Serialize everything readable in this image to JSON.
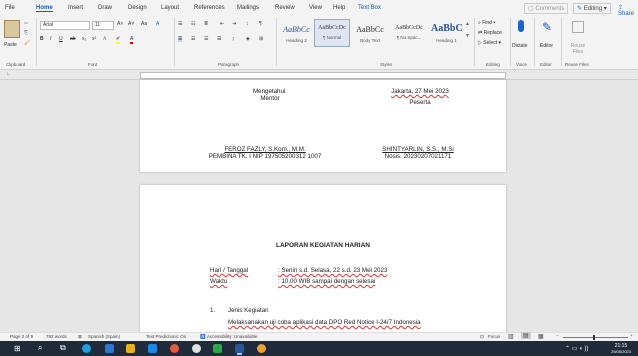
{
  "tabs": [
    "File",
    "Home",
    "Insert",
    "Draw",
    "Design",
    "Layout",
    "References",
    "Mailings",
    "Review",
    "View",
    "Help",
    "Text Box"
  ],
  "right_controls": {
    "comments": "Comments",
    "editing": "Editing",
    "share": "Share"
  },
  "clipboard": {
    "paste": "Paste",
    "group": "Clipboard"
  },
  "font": {
    "name": "Arial",
    "size": "11",
    "group": "Font"
  },
  "paragraph": {
    "group": "Paragraph"
  },
  "styles": {
    "group": "Styles",
    "items": [
      {
        "preview": "AaBbCc",
        "name": "Heading 2"
      },
      {
        "preview": "AaBbCcDc",
        "name": "¶ Normal"
      },
      {
        "preview": "AaBbCc",
        "name": "Body Text"
      },
      {
        "preview": "AaBbCcDc",
        "name": "¶ No Spac..."
      },
      {
        "preview": "AaBbC",
        "name": "Heading 1"
      }
    ]
  },
  "editing": {
    "find": "Find",
    "replace": "Replace",
    "select": "Select",
    "group": "Editing"
  },
  "voice": {
    "dictate": "Dictate",
    "group": "Voice"
  },
  "editor": {
    "label": "Editor",
    "group": "Editor"
  },
  "reuse": {
    "label": "Reuse Files",
    "group": "Reuse Files"
  },
  "page1": {
    "left_heading": "Mengetahui:",
    "left_role": "Mentor",
    "right_date": "Jakarta, 27 Mei 2023",
    "right_role": "Peserta",
    "left_name": "FEROZ FAZLY, S.Kom., M.M.",
    "left_id": "PEMBINA TK. I NIP 197505200312 1007",
    "right_name": "SHINTYARLIN, S.S., M.Si",
    "right_id": "Nosis. 20230207021171"
  },
  "page2": {
    "title": "LAPORAN KEGIATAN HARIAN",
    "row1_label": "Hari / Tanggal",
    "row1_value": ": Senin s.d. Selasa, 22 s.d. 23 Mei 2023",
    "row2_label": "Waktu",
    "row2_value": ": 10.00 WIB sampai dengan selesai",
    "item_number": "1.",
    "item_title": "Jenis Kegiatan",
    "item_text": "Melaksanakan uji coba aplikasi data DPO Red Notice I-24/7 Indonesia"
  },
  "status": {
    "page": "Page 2 of 9",
    "words": "793 words",
    "language": "Spanish (Spain)",
    "predictions": "Text Predictions: On",
    "accessibility": "Accessibility: Unavailable",
    "focus": "Focus"
  },
  "clock": {
    "time": "21:15",
    "date": "29/05/2023"
  }
}
